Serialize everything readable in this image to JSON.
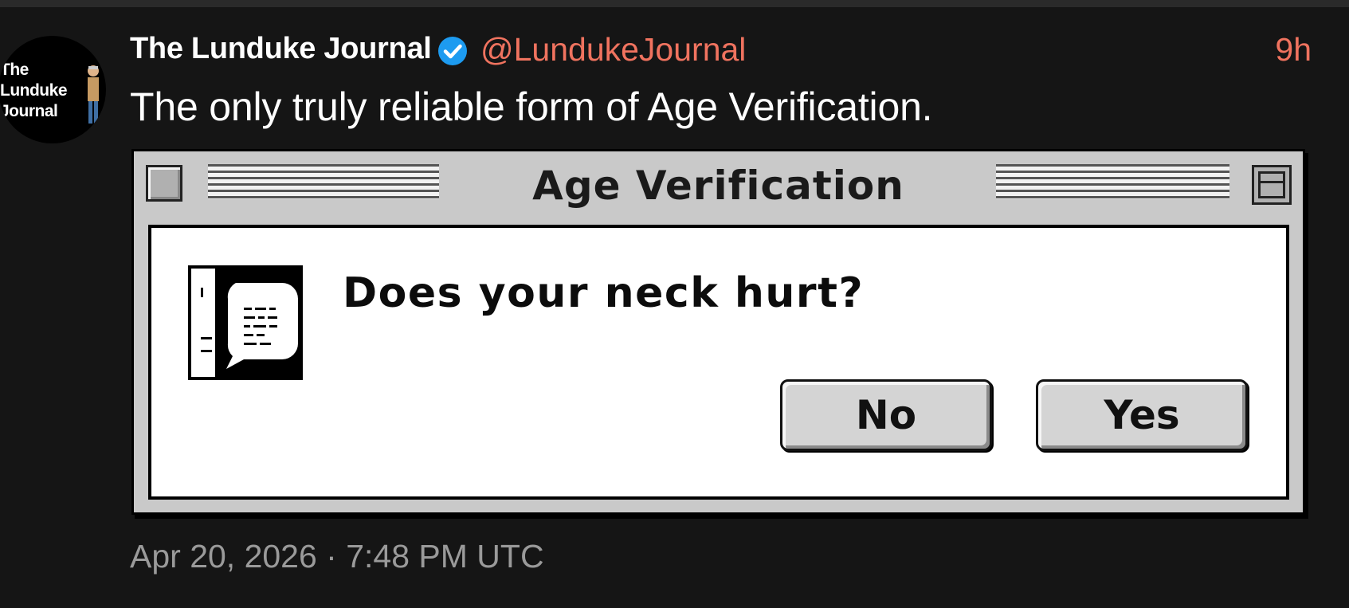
{
  "tweet": {
    "avatar": {
      "lines": [
        "The",
        "Lunduke",
        "Journal"
      ]
    },
    "author_name": "The Lunduke Journal",
    "verified": true,
    "handle": "@LundukeJournal",
    "time_ago": "9h",
    "text": "The only truly reliable form of Age Verification.",
    "timestamp": "Apr 20, 2026 · 7:48 PM UTC"
  },
  "dialog": {
    "title": "Age Verification",
    "question": "Does your neck hurt?",
    "no_label": "No",
    "yes_label": "Yes",
    "icon": "speech-bubble-face-icon"
  },
  "colors": {
    "background": "#151515",
    "handle": "#f0735f",
    "verified": "#1d9bf0",
    "timestamp": "#9a9a9a"
  }
}
